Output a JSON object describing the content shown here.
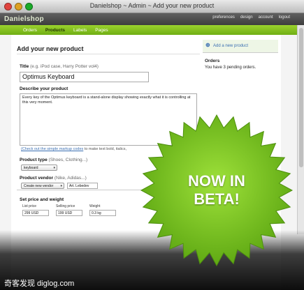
{
  "window": {
    "title": "Danielshop ~ Admin ~ Add your new product"
  },
  "header": {
    "logo": "Danielshop",
    "links": [
      "preferences",
      "design",
      "account",
      "logout"
    ]
  },
  "tabs": [
    {
      "label": "Orders",
      "active": false
    },
    {
      "label": "Products",
      "active": true
    },
    {
      "label": "Labels",
      "active": false
    },
    {
      "label": "Pages",
      "active": false
    }
  ],
  "form": {
    "heading": "Add your new product",
    "title_label": "Title",
    "title_hint": "(e.g. iPod case, Harry Potter vol4)",
    "title_value": "Optimus Keyboard",
    "describe_label": "Describe your product",
    "describe_value": "Every key of the Optimus keyboard is a stand-alone display showing exactly what it is controlling at this very moment.",
    "markup_link": "(Check out the simple markup codes",
    "markup_rest": "to make text bold, italics,",
    "type_label": "Product type",
    "type_hint": "(Shoes, Clothing...)",
    "type_value": "keyboard",
    "vendor_label": "Product vendor",
    "vendor_hint": "(Nike, Adidas...)",
    "vendor_select": "Create new vendor",
    "vendor_value": "Art. Lebedev",
    "price_heading": "Set price and weight",
    "list_price_label": "List price",
    "list_price_value": "299 USD",
    "selling_price_label": "Selling price",
    "selling_price_value": "199 USD",
    "weight_label": "Weight",
    "weight_value": "0.3 kg"
  },
  "sidebar": {
    "add_link": "Add a new product",
    "orders_title": "Orders",
    "orders_text": "You have 3 pending orders."
  },
  "badge": {
    "line1": "NOW IN",
    "line2": "BETA!"
  },
  "watermark": "奇客发现 diglog.com",
  "colors": {
    "green": "#7fc21d",
    "badge": "#7dc520",
    "link": "#3b6fb2"
  }
}
